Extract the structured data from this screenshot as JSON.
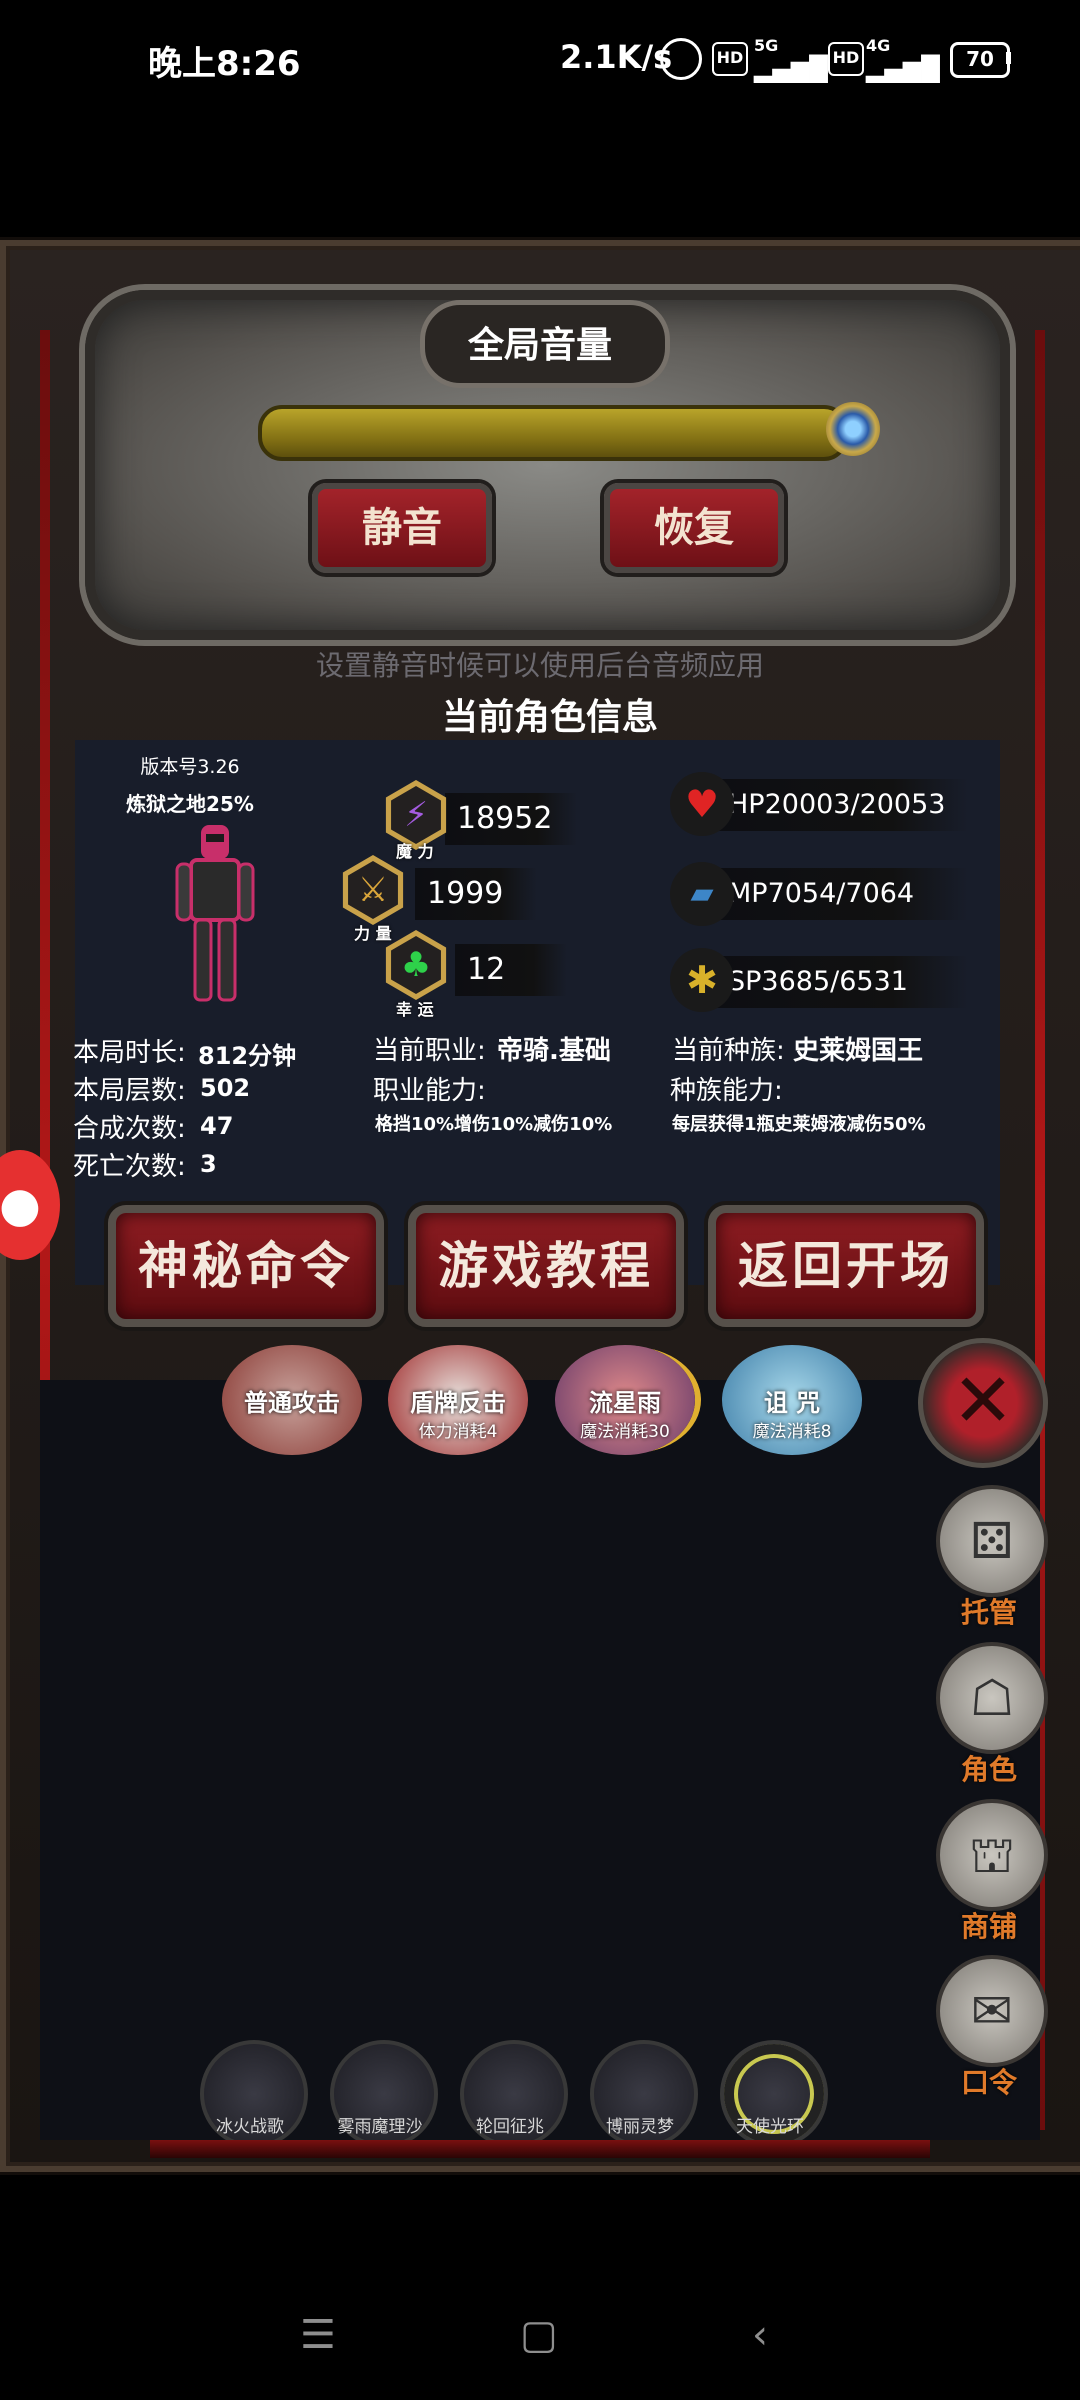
{
  "status_bar": {
    "time": "晚上8:26",
    "net_speed": "2.1K/s",
    "hd1": "HD",
    "net1": "5G",
    "hd2": "HD",
    "net2": "4G",
    "battery": "70"
  },
  "volume_panel": {
    "title": "全局音量",
    "mute_label": "静音",
    "restore_label": "恢复",
    "hint": "设置静音时候可以使用后台音频应用",
    "level": 1.0
  },
  "info_panel": {
    "title": "当前角色信息",
    "version": "版本号3.26",
    "difficulty": "炼狱之地25%",
    "magic": {
      "label": "魔 力",
      "value": "18952"
    },
    "strength": {
      "label": "力 量",
      "value": "1999"
    },
    "luck": {
      "label": "幸 运",
      "value": "12"
    },
    "hp": "HP20003/20053",
    "mp": "MP7054/7064",
    "sp": "SP3685/6531",
    "stats": [
      {
        "label": "本局时长:",
        "value": "812分钟"
      },
      {
        "label": "本局层数:",
        "value": "502"
      },
      {
        "label": "合成次数:",
        "value": "47"
      },
      {
        "label": "死亡次数:",
        "value": "3"
      }
    ],
    "job_label": "当前职业:",
    "job_value": "帝骑.基础",
    "job_ability_label": "职业能力:",
    "job_ability": "格挡10%增伤10%减伤10%",
    "race_label": "当前种族:",
    "race_value": "史莱姆国王",
    "race_ability_label": "种族能力:",
    "race_ability": "每层获得1瓶史莱姆液减伤50%"
  },
  "buttons": {
    "secret": "神秘命令",
    "tutorial": "游戏教程",
    "return": "返回开场"
  },
  "skills": [
    {
      "name": "普通攻击",
      "cost": ""
    },
    {
      "name": "盾牌反击",
      "cost": "体力消耗4"
    },
    {
      "name": "流星雨",
      "cost": "魔法消耗30"
    },
    {
      "name": "诅 咒",
      "cost": "魔法消耗8"
    }
  ],
  "side_menu": {
    "auto": "托管",
    "character": "角色",
    "shop": "商铺",
    "code": "口令"
  },
  "monsters": [
    "冰火战歌",
    "雾雨魔理沙",
    "轮回征兆",
    "博丽灵梦",
    "天使光环"
  ],
  "icons": {
    "close": "close-icon",
    "dice": "dice-icon",
    "hood": "hooded-figure-icon",
    "shop": "shop-icon",
    "scroll": "scroll-icon"
  }
}
